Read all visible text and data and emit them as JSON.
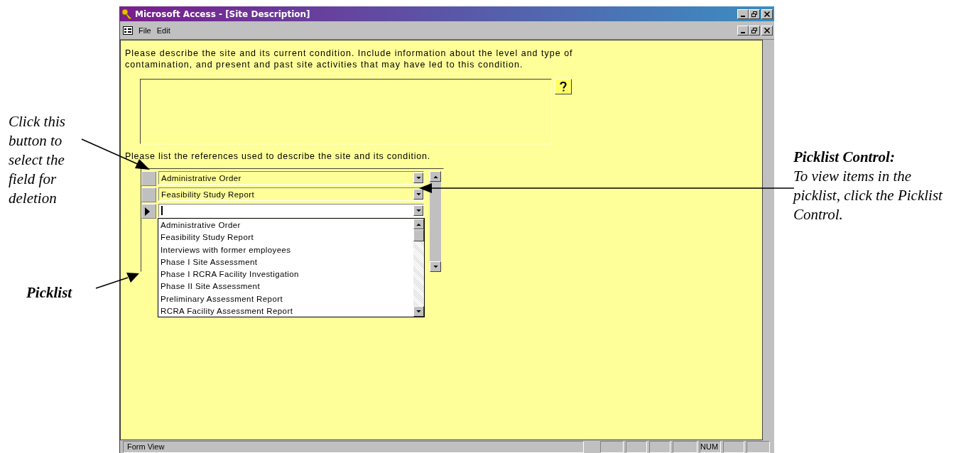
{
  "window": {
    "title": "Microsoft Access - [Site Description]"
  },
  "menu": [
    {
      "label": "File"
    },
    {
      "label": "Edit"
    }
  ],
  "form": {
    "description_prompt": "Please describe the site and its current condition. Include information about the level and type of contamination, and present and past site activities that may have led to this condition.",
    "references_prompt": "Please list the references used to describe the site and its condition.",
    "references": [
      {
        "value": "Administrative Order",
        "current": false
      },
      {
        "value": "Feasibility Study Report",
        "current": false
      },
      {
        "current": true
      }
    ],
    "picklist": {
      "expanded": true,
      "items": [
        "Administrative Order",
        "Feasibility Study Report",
        "Interviews with former employees",
        "Phase I Site Assessment",
        "Phase I RCRA Facility Investigation",
        "Phase II Site Assessment",
        "Preliminary Assessment Report",
        "RCRA Facility Assessment Report"
      ]
    }
  },
  "status_bar": {
    "text": "Form View",
    "indicator": "NUM"
  },
  "annotations": [
    {
      "kind": "note",
      "text": "Click this button to select the field for deletion"
    },
    {
      "kind": "label",
      "text": "Picklist"
    },
    {
      "kind": "callout",
      "heading": "Picklist Control:",
      "text": "To view items in the picklist, click the Picklist Control."
    }
  ]
}
